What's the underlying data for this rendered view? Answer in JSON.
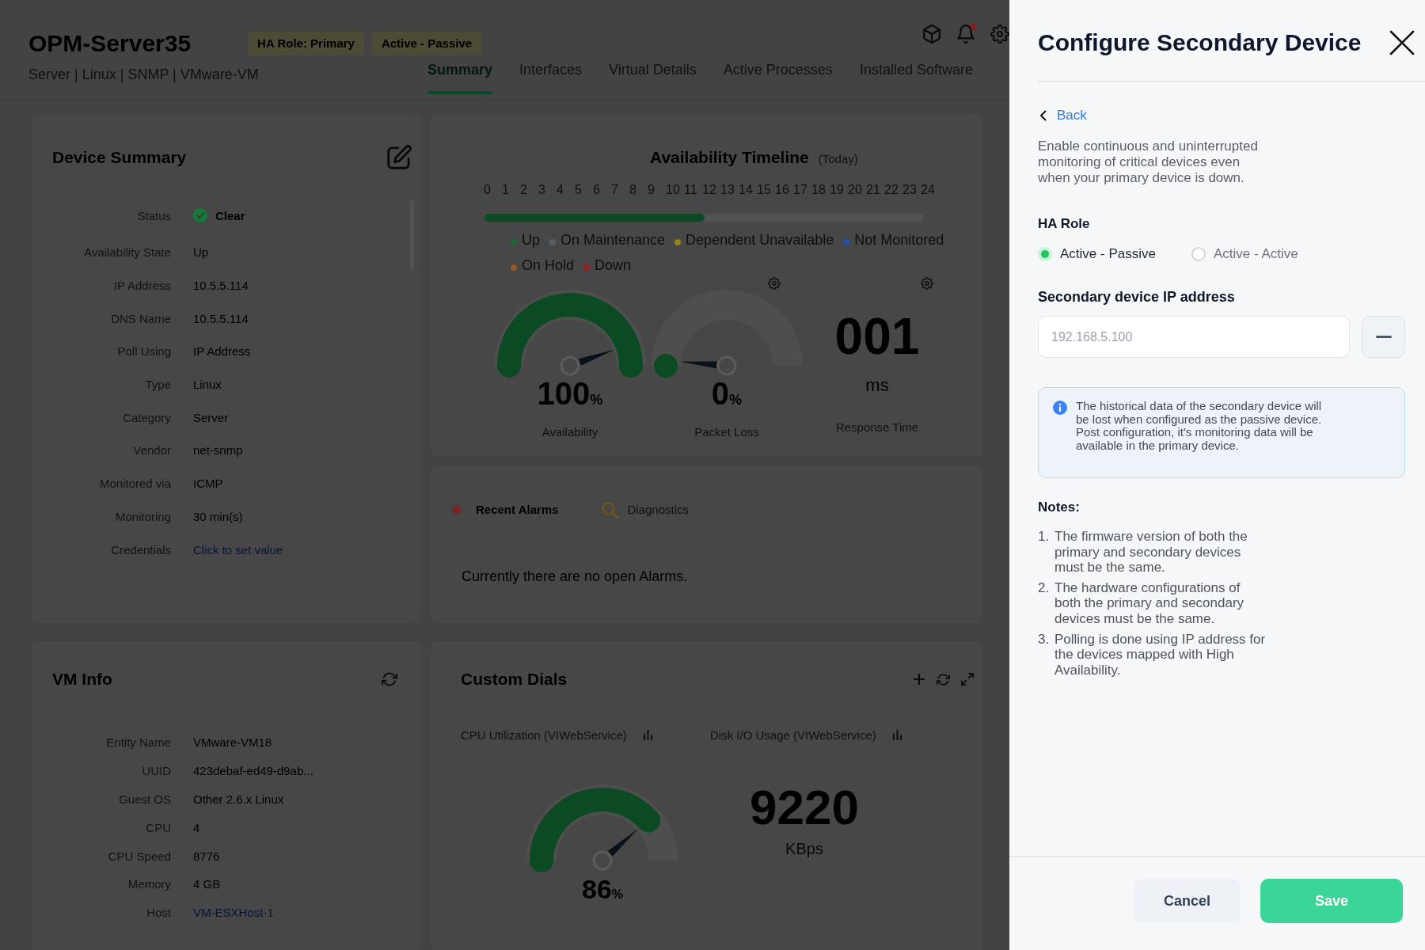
{
  "header": {
    "title": "OPM-Server35",
    "badges": [
      {
        "label": "HA Role: Primary"
      },
      {
        "label": "Active - Passive"
      }
    ],
    "subtitle": "Server | Linux | SNMP | VMware-VM",
    "unread_notifications": true,
    "tabs": [
      {
        "label": "Summary",
        "selected": true
      },
      {
        "label": "Interfaces",
        "selected": false
      },
      {
        "label": "Virtual Details",
        "selected": false
      },
      {
        "label": "Active Processes",
        "selected": false
      },
      {
        "label": "Installed Software",
        "selected": false
      }
    ]
  },
  "device_summary": {
    "title": "Device Summary",
    "rows": [
      {
        "label": "Status",
        "value": "Clear",
        "kind": "status"
      },
      {
        "label": "Availability State",
        "value": "Up",
        "kind": "text"
      },
      {
        "label": "IP Address",
        "value": "10.5.5.114",
        "kind": "text"
      },
      {
        "label": "DNS Name",
        "value": "10.5.5.114",
        "kind": "text"
      },
      {
        "label": "Poll Using",
        "value": "IP Address",
        "kind": "text"
      },
      {
        "label": "Type",
        "value": "Linux",
        "kind": "text"
      },
      {
        "label": "Category",
        "value": "Server",
        "kind": "text"
      },
      {
        "label": "Vendor",
        "value": "net-snmp",
        "kind": "text"
      },
      {
        "label": "Monitored via",
        "value": "ICMP",
        "kind": "text"
      },
      {
        "label": "Monitoring",
        "value": "30 min(s)",
        "kind": "text"
      },
      {
        "label": "Credentials",
        "value": "Click to set value",
        "kind": "link"
      }
    ]
  },
  "availability": {
    "title": "Availability Timeline",
    "period": "(Today)",
    "hours": [
      "0",
      "1",
      "2",
      "3",
      "4",
      "5",
      "6",
      "7",
      "8",
      "9",
      "10",
      "11",
      "12",
      "13",
      "14",
      "15",
      "16",
      "17",
      "18",
      "19",
      "20",
      "21",
      "22",
      "23",
      "24"
    ],
    "timeline": {
      "level": 0.5
    },
    "legend": [
      {
        "label": "Up",
        "color": "#1a6a30"
      },
      {
        "label": "On Maintenance",
        "color": "#5a6068"
      },
      {
        "label": "Dependent Unavailable",
        "color": "#94840f"
      },
      {
        "label": "Not Monitored",
        "color": "#2850a8"
      },
      {
        "label": "On Hold",
        "color": "#9a561e"
      },
      {
        "label": "Down",
        "color": "#9a2020"
      }
    ],
    "meters": [
      {
        "kind": "gauge",
        "value": "100",
        "unit": "%",
        "label": "Availability",
        "level": 1,
        "configurable": false
      },
      {
        "kind": "gauge",
        "value": "0",
        "unit": "%",
        "label": "Packet Loss",
        "level": 0,
        "configurable": true
      },
      {
        "kind": "number",
        "value": "001",
        "unit": "ms",
        "label": "Response Time",
        "configurable": true
      }
    ]
  },
  "alarms": {
    "tabs": [
      {
        "label": "Recent Alarms",
        "kind": "alarms",
        "selected": true
      },
      {
        "label": "Diagnostics",
        "kind": "diagnostics",
        "selected": false
      }
    ],
    "message": "Currently there are no open Alarms."
  },
  "vm_info": {
    "title": "VM Info",
    "rows": [
      {
        "label": "Entity Name",
        "value": "VMware-VM18",
        "kind": "text"
      },
      {
        "label": "UUID",
        "value": "423debaf-ed49-d9ab...",
        "kind": "text"
      },
      {
        "label": "Guest OS",
        "value": "Other 2.6.x Linux",
        "kind": "text"
      },
      {
        "label": "CPU",
        "value": "4",
        "kind": "text"
      },
      {
        "label": "CPU Speed",
        "value": "8776",
        "kind": "text"
      },
      {
        "label": "Memory",
        "value": "4 GB",
        "kind": "text"
      },
      {
        "label": "Host",
        "value": "VM-ESXHost-1",
        "kind": "link"
      }
    ]
  },
  "custom_dials": {
    "title": "Custom Dials",
    "dials": [
      {
        "title": "CPU Utilization (VIWebService)",
        "kind": "gauge",
        "value": "86",
        "unit": "%",
        "level": 0.86
      },
      {
        "title": "Disk I/O Usage (VIWebService)",
        "kind": "number",
        "value": "9220",
        "unit": "KBps"
      }
    ]
  },
  "panel": {
    "title": "Configure Secondary Device",
    "back": "Back",
    "description": "Enable continuous and uninterrupted monitoring of critical devices even when your primary device is down.",
    "ha_role": {
      "label": "HA Role",
      "options": [
        {
          "label": "Active - Passive",
          "selected": true
        },
        {
          "label": "Active - Active",
          "selected": false
        }
      ]
    },
    "ip_address": {
      "label": "Secondary device IP address",
      "placeholder": "192.168.5.100"
    },
    "info": "The historical data of the secondary device will be lost when configured as the passive device. Post configuration, it's monitoring data will be available in the primary device.",
    "notes": {
      "title": "Notes:",
      "items": [
        {
          "number": "1.",
          "text": "The firmware version of both the primary and secondary devices must be the same."
        },
        {
          "number": "2.",
          "text": "The hardware configurations of both the primary and secondary devices must be the same."
        },
        {
          "number": "3.",
          "text": "Polling is done using IP address for the devices mapped with High Availability."
        }
      ]
    },
    "buttons": [
      {
        "label": "Cancel",
        "kind": "secondary"
      },
      {
        "label": "Save",
        "kind": "primary"
      }
    ]
  }
}
